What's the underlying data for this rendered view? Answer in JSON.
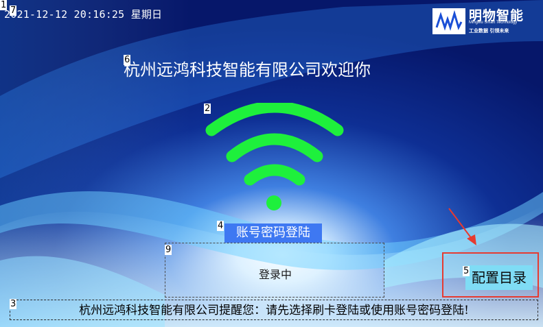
{
  "header": {
    "datetime": "2021-12-12 20:16:25 星期日",
    "logo_name": "明物智能",
    "logo_sub": "Mingwu Smart Technology",
    "logo_slogan": "工业数据 引领未来"
  },
  "welcome": {
    "text": "杭州远鸿科技智能有限公司欢迎你"
  },
  "wifi": {
    "icon": "wifi-icon",
    "color": "#1ef03c"
  },
  "login": {
    "mode_button": "账号密码登陆",
    "status": "登录中"
  },
  "footer": {
    "tip": "杭州远鸿科技智能有限公司提醒您：请先选择刷卡登陆或使用账号密码登陆!"
  },
  "config": {
    "button": "配置目录",
    "highlight_color": "#e63a30"
  },
  "markers": {
    "m1": "1",
    "m2": "2",
    "m3": "3",
    "m4": "4",
    "m5": "5",
    "m6": "6",
    "m7": "7",
    "m9": "9"
  },
  "colors": {
    "accent_blue": "#3e78f2",
    "config_bg": "#7fdcf5"
  }
}
